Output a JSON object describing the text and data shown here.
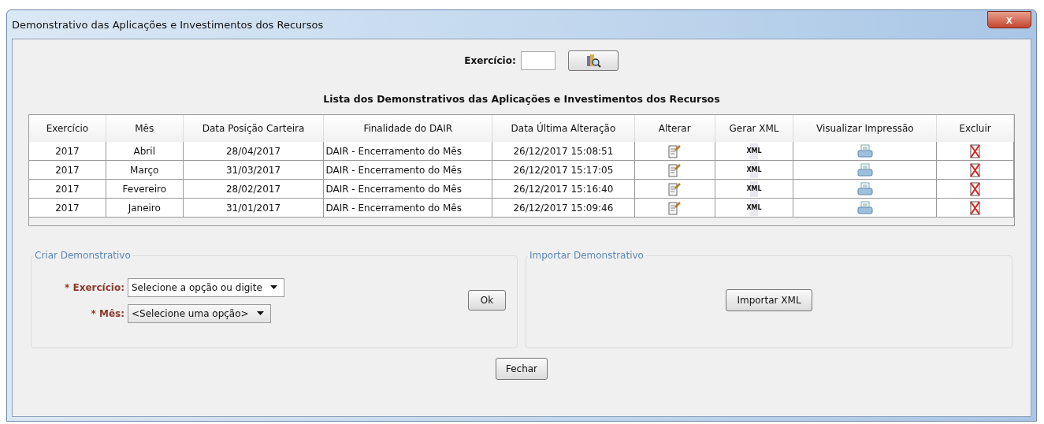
{
  "window": {
    "title": "Demonstrativo das Aplicações e Investimentos dos Recursos",
    "close": "x"
  },
  "filter": {
    "label": "Exercício:"
  },
  "table": {
    "title": "Lista dos Demonstrativos das Aplicações e Investimentos dos Recursos",
    "columns": [
      "Exercício",
      "Mês",
      "Data Posição Carteira",
      "Finalidade do DAIR",
      "Data Última Alteração",
      "Alterar",
      "Gerar XML",
      "Visualizar Impressão",
      "Excluir"
    ],
    "rows": [
      {
        "exercicio": "2017",
        "mes": "Abril",
        "data_posicao": "28/04/2017",
        "finalidade": "DAIR - Encerramento do Mês",
        "data_alteracao": "26/12/2017 15:08:51",
        "xml_icon_text": "XML"
      },
      {
        "exercicio": "2017",
        "mes": "Março",
        "data_posicao": "31/03/2017",
        "finalidade": "DAIR - Encerramento do Mês",
        "data_alteracao": "26/12/2017 15:17:05",
        "xml_icon_text": "XML"
      },
      {
        "exercicio": "2017",
        "mes": "Fevereiro",
        "data_posicao": "28/02/2017",
        "finalidade": "DAIR - Encerramento do Mês",
        "data_alteracao": "26/12/2017 15:16:40",
        "xml_icon_text": "XML"
      },
      {
        "exercicio": "2017",
        "mes": "Janeiro",
        "data_posicao": "31/01/2017",
        "finalidade": "DAIR - Encerramento do Mês",
        "data_alteracao": "26/12/2017 15:09:46",
        "xml_icon_text": "XML"
      }
    ]
  },
  "criar": {
    "legend": "Criar Demonstrativo",
    "fields": [
      {
        "required_mark": "*",
        "label": "Exercício:",
        "value": "Selecione a opção ou digite",
        "kind": "editable"
      },
      {
        "required_mark": "*",
        "label": "Mês:",
        "value": "<Selecione uma opção>",
        "kind": "readonly"
      }
    ],
    "button": "Ok"
  },
  "importar": {
    "legend": "Importar Demonstrativo",
    "button": "Importar XML"
  },
  "close_button": "Fechar"
}
